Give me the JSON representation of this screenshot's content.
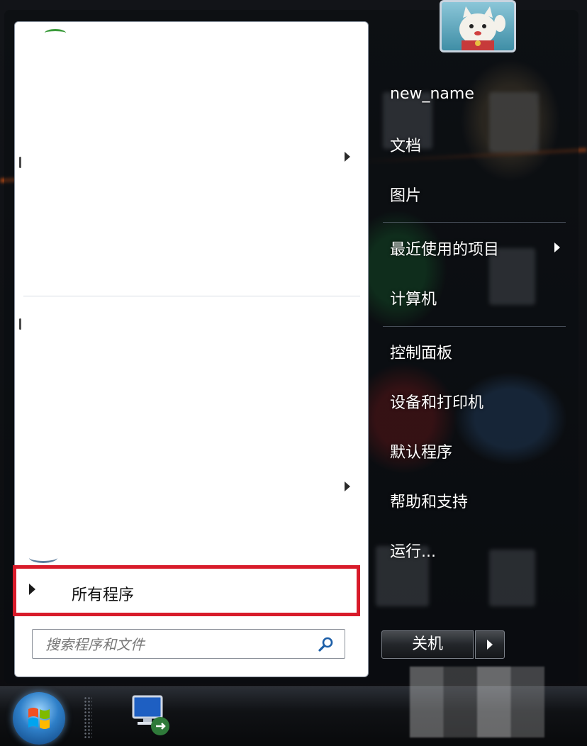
{
  "left_pane": {
    "all_programs_label": "所有程序",
    "search_placeholder": "搜索程序和文件"
  },
  "right_pane": {
    "items": [
      {
        "label": "new_name"
      },
      {
        "label": "文档"
      },
      {
        "label": "图片"
      },
      {
        "label": "最近使用的项目"
      },
      {
        "label": "计算机"
      },
      {
        "label": "控制面板"
      },
      {
        "label": "设备和打印机"
      },
      {
        "label": "默认程序"
      },
      {
        "label": "帮助和支持"
      },
      {
        "label": "运行..."
      }
    ],
    "shutdown_label": "关机"
  },
  "colors": {
    "highlight_border": "#d81b2a",
    "menu_left_bg": "#ffffff",
    "menu_right_text": "#ffffff"
  },
  "icons": {
    "user_avatar": "lucky-cat-avatar",
    "search": "magnifier-icon",
    "start": "windows-orb",
    "taskbar_app": "remote-desktop-icon"
  }
}
